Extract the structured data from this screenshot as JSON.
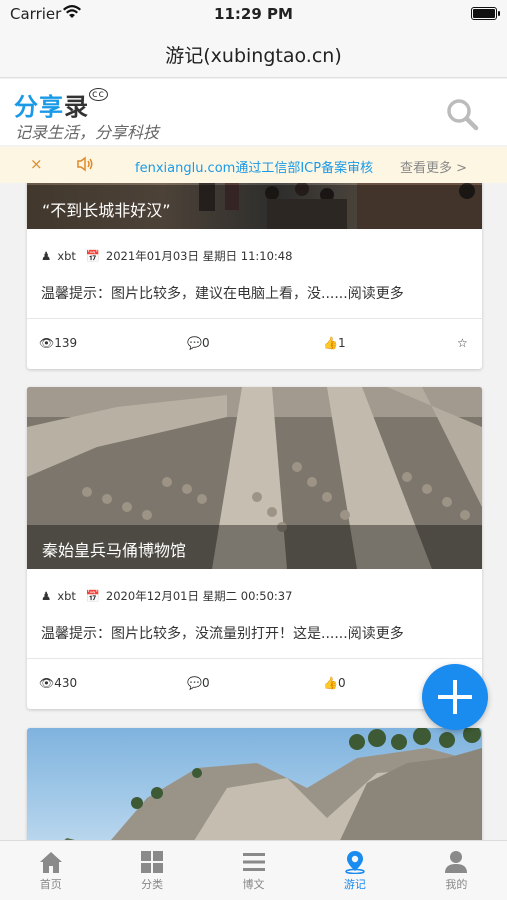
{
  "status": {
    "carrier": "Carrier",
    "time": "11:29 PM"
  },
  "nav": {
    "title": "游记(xubingtao.cn)"
  },
  "header": {
    "logo": [
      "分",
      "享",
      "录"
    ],
    "logo_mark": "cc",
    "slogan": "记录生活，分享科技"
  },
  "notice": {
    "close": "×",
    "text": "fenxianglu.com通过工信部ICP备案审核",
    "more": "查看更多 >"
  },
  "posts": [
    {
      "title": "“不到长城非好汉”",
      "author": "xbt",
      "date": "2021年01月03日 星期日 11:10:48",
      "excerpt": "温馨提示：图片比较多，建议在电脑上看，没......阅读更多",
      "views": "139",
      "comments": "0",
      "likes": "1"
    },
    {
      "title": "秦始皇兵马俑博物馆",
      "author": "xbt",
      "date": "2020年12月01日 星期二 00:50:37",
      "excerpt": "温馨提示：图片比较多，没流量别打开！这是......阅读更多",
      "views": "430",
      "comments": "0",
      "likes": "0"
    }
  ],
  "tabs": [
    {
      "label": "首页",
      "icon": "home-icon"
    },
    {
      "label": "分类",
      "icon": "grid-icon"
    },
    {
      "label": "博文",
      "icon": "list-icon"
    },
    {
      "label": "游记",
      "icon": "location-icon"
    },
    {
      "label": "我的",
      "icon": "user-icon"
    }
  ],
  "colors": {
    "accent": "#1a8bef",
    "notice_bg": "#fdf6e3",
    "notice_text": "#1a9ae6"
  }
}
